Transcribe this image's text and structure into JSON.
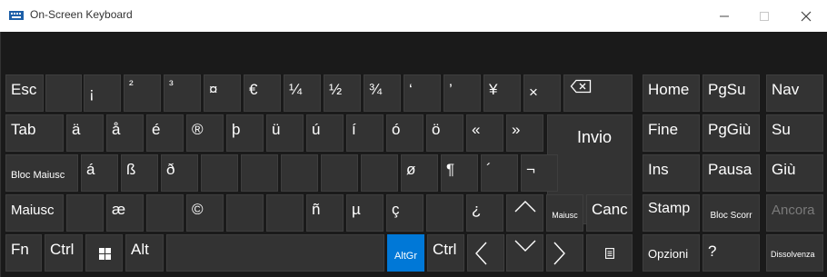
{
  "window": {
    "title": "On-Screen Keyboard",
    "minimize_icon": "minimize-icon",
    "maximize_icon": "maximize-icon",
    "close_icon": "close-icon"
  },
  "keys": {
    "esc": "Esc",
    "i_dotless": "¡",
    "sup2": "²",
    "sup3": "³",
    "currency": "¤",
    "euro": "€",
    "quarter": "¼",
    "half": "½",
    "three_quarters": "¾",
    "lquote": "‘",
    "rquote": "’",
    "yen": "¥",
    "times": "×",
    "backspace_icon": "backspace-icon",
    "tab": "Tab",
    "a_uml": "ä",
    "a_ring": "å",
    "e_acute": "é",
    "registered": "®",
    "thorn": "þ",
    "u_uml": "ü",
    "u_acute": "ú",
    "i_acute": "í",
    "o_acute": "ó",
    "o_uml": "ö",
    "laquo": "«",
    "raquo": "»",
    "invio": "Invio",
    "bloc_maiusc": "Bloc Maiusc",
    "a_acute": "á",
    "eszett": "ß",
    "eth": "ð",
    "o_slash": "ø",
    "pilcrow": "¶",
    "acute_accent": "´",
    "not_sign": "¬",
    "maiusc_left": "Maiusc",
    "ae": "æ",
    "copyright": "©",
    "n_tilde": "ñ",
    "mu": "µ",
    "c_cedilla": "ç",
    "inv_question": "¿",
    "up_icon": "arrow-up-icon",
    "maiusc_right": "Maiusc",
    "canc": "Canc",
    "fn": "Fn",
    "ctrl_left": "Ctrl",
    "windows_icon": "windows-icon",
    "alt": "Alt",
    "altgr": "AltGr",
    "ctrl_right": "Ctrl",
    "left_icon": "arrow-left-icon",
    "down_icon": "arrow-down-icon",
    "right_icon": "arrow-right-icon",
    "menu_icon": "menu-icon",
    "home": "Home",
    "pgsu": "PgSu",
    "nav": "Nav",
    "fine": "Fine",
    "pggiu": "PgGiù",
    "su": "Su",
    "ins": "Ins",
    "pausa": "Pausa",
    "giu": "Giù",
    "stamp": "Stamp",
    "bloc_scorr": "Bloc Scorr",
    "ancora": "Ancora",
    "opzioni": "Opzioni",
    "help": "?",
    "dissolvenza": "Dissolvenza"
  },
  "colors": {
    "accent": "#0078d7",
    "key_bg": "#333333",
    "board_bg": "#1a1a1a"
  }
}
